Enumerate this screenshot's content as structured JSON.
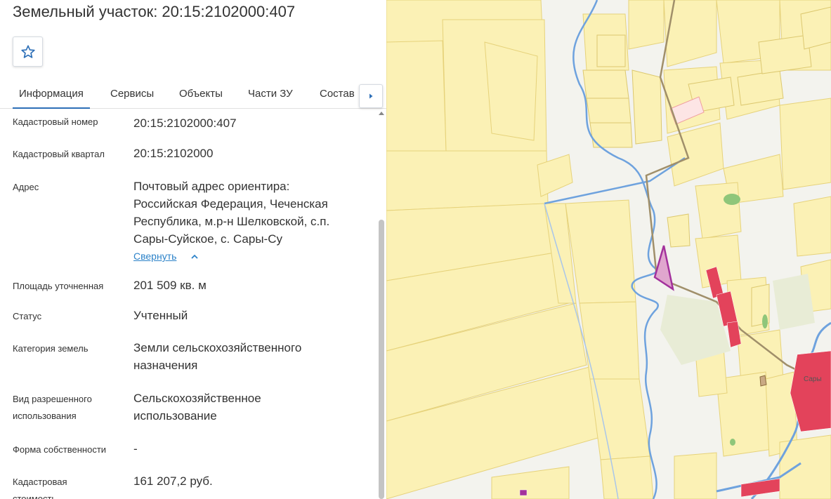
{
  "panel": {
    "title": "Земельный участок: 20:15:2102000:407",
    "favorite_icon": "star-outline-icon",
    "tabs": [
      "Информация",
      "Сервисы",
      "Объекты",
      "Части ЗУ",
      "Состав"
    ],
    "tabs_next_icon": "triangle-right-icon",
    "info": {
      "cad_number_label": "Кадастровый номер",
      "cad_number_value": "20:15:2102000:407",
      "cad_quarter_label": "Кадастровый квартал",
      "cad_quarter_value": "20:15:2102000",
      "address_label": "Адрес",
      "address_lines": [
        "Почтовый адрес ориентира:",
        "Российская Федерация, Чеченская",
        "Республика, м.р-н Шелковской, с.п.",
        "Сары-Суйское, с. Сары-Су"
      ],
      "collapse_label": "Свернуть",
      "area_label": "Площадь уточненная",
      "area_value": "201 509 кв. м",
      "status_label": "Статус",
      "status_value": "Учтенный",
      "category_label": "Категория земель",
      "category_lines": [
        "Земли сельскохозяйственного",
        "назначения"
      ],
      "permitted_use_label_lines": [
        "Вид разрешенного",
        "использования"
      ],
      "permitted_use_lines": [
        "Сельскохозяйственное",
        "использование"
      ],
      "ownership_label": "Форма собственности",
      "ownership_value": "-",
      "cost_label_lines": [
        "Кадастровая",
        "стоимость"
      ],
      "cost_value": "161 207,2 руб."
    }
  },
  "map": {
    "colors": {
      "parcel_fill": "#fbf1b5",
      "parcel_stroke": "#e6d27a",
      "river": "#6ea2de",
      "road": "#a08f6a",
      "selected_parcel": "#a3319c",
      "settlement": "#e3435b"
    },
    "village_label": "Сары"
  }
}
